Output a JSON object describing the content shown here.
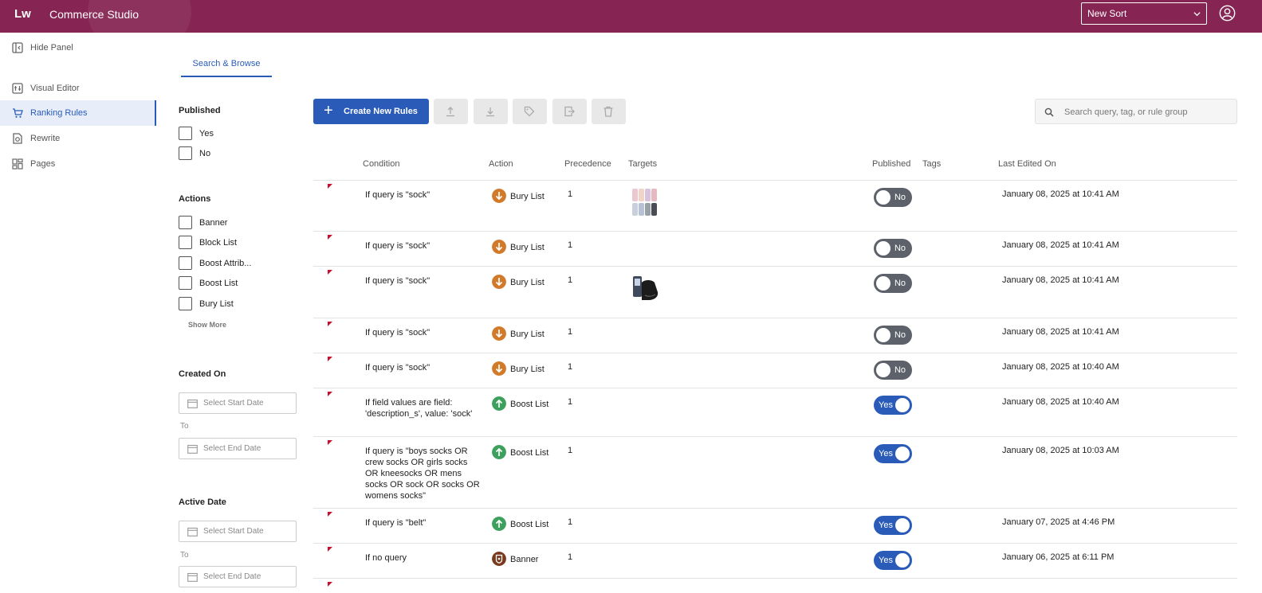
{
  "header": {
    "logo": "Lw",
    "title": "Commerce Studio",
    "sort_select": "New Sort"
  },
  "sidebar": {
    "hide_panel": "Hide Panel",
    "items": [
      {
        "label": "Visual Editor"
      },
      {
        "label": "Ranking Rules"
      },
      {
        "label": "Rewrite"
      },
      {
        "label": "Pages"
      }
    ]
  },
  "tab": "Search & Browse",
  "filters": {
    "published": {
      "title": "Published",
      "options": [
        "Yes",
        "No"
      ]
    },
    "actions": {
      "title": "Actions",
      "options": [
        "Banner",
        "Block List",
        "Boost Attrib...",
        "Boost List",
        "Bury List"
      ],
      "show_more": "Show More"
    },
    "created_on": {
      "title": "Created On",
      "start": "Select Start Date",
      "to": "To",
      "end": "Select End Date"
    },
    "active_date": {
      "title": "Active Date",
      "start": "Select Start Date",
      "to": "To",
      "end": "Select End Date"
    }
  },
  "toolbar": {
    "create": "Create New Rules",
    "search_placeholder": "Search query, tag, or rule group"
  },
  "table": {
    "columns": [
      "Condition",
      "Action",
      "Precedence",
      "Targets",
      "Published",
      "Tags",
      "Last Edited On"
    ],
    "rows": [
      {
        "condition": "If query is \"sock\"",
        "action": "Bury List",
        "precedence": "1",
        "published": "No",
        "edited": "January 08, 2025 at 10:41 AM"
      },
      {
        "condition": "If query is \"sock\"",
        "action": "Bury List",
        "precedence": "1",
        "published": "No",
        "edited": "January 08, 2025 at 10:41 AM"
      },
      {
        "condition": "If query is \"sock\"",
        "action": "Bury List",
        "precedence": "1",
        "published": "No",
        "edited": "January 08, 2025 at 10:41 AM"
      },
      {
        "condition": "If query is \"sock\"",
        "action": "Bury List",
        "precedence": "1",
        "published": "No",
        "edited": "January 08, 2025 at 10:41 AM"
      },
      {
        "condition": "If query is \"sock\"",
        "action": "Bury List",
        "precedence": "1",
        "published": "No",
        "edited": "January 08, 2025 at 10:40 AM"
      },
      {
        "condition": "If field values are field: 'description_s', value: 'sock'",
        "action": "Boost List",
        "precedence": "1",
        "published": "Yes",
        "edited": "January 08, 2025 at 10:40 AM"
      },
      {
        "condition": "If query is \"boys socks OR crew socks OR girls socks OR kneesocks OR mens socks OR sock OR socks OR womens socks\"",
        "action": "Boost List",
        "precedence": "1",
        "published": "Yes",
        "edited": "January 08, 2025 at 10:03 AM"
      },
      {
        "condition": "If query is \"belt\"",
        "action": "Boost List",
        "precedence": "1",
        "published": "Yes",
        "edited": "January 07, 2025 at 4:46 PM"
      },
      {
        "condition": "If no query",
        "action": "Banner",
        "precedence": "1",
        "published": "Yes",
        "edited": "January 06, 2025 at 6:11 PM"
      }
    ]
  },
  "colors": {
    "brand": "#862553",
    "accent": "#2a5bb8",
    "bury": "#d17a2a",
    "boost": "#3ea05d",
    "banner": "#7a3a1f",
    "flag": "#c8102e"
  }
}
